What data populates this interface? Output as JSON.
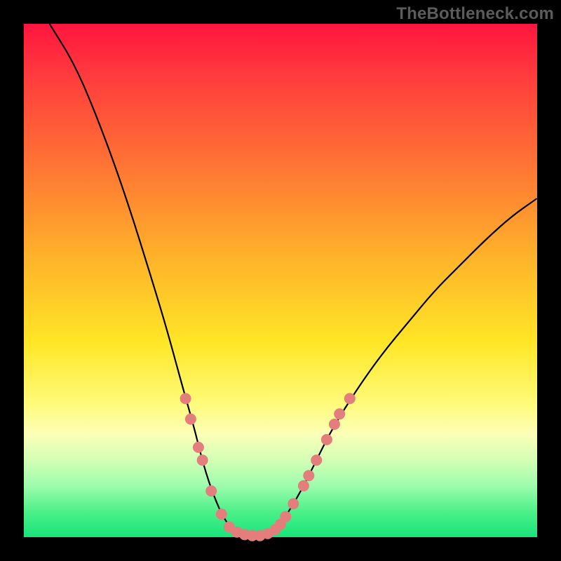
{
  "watermark": "TheBottleneck.com",
  "colors": {
    "curve_stroke": "#000000",
    "marker_fill": "#e47e7c",
    "marker_stroke": "#c95a58",
    "frame_bg": "#000000"
  },
  "chart_data": {
    "type": "line",
    "title": "",
    "xlabel": "",
    "ylabel": "",
    "xlim": [
      0,
      100
    ],
    "ylim": [
      0,
      100
    ],
    "grid": false,
    "legend": false,
    "curve": [
      {
        "x": 5.0,
        "y": 100.0
      },
      {
        "x": 10.0,
        "y": 92.0
      },
      {
        "x": 15.0,
        "y": 80.0
      },
      {
        "x": 20.0,
        "y": 66.0
      },
      {
        "x": 25.0,
        "y": 50.0
      },
      {
        "x": 28.0,
        "y": 40.0
      },
      {
        "x": 31.0,
        "y": 29.0
      },
      {
        "x": 33.0,
        "y": 22.0
      },
      {
        "x": 35.0,
        "y": 14.0
      },
      {
        "x": 37.0,
        "y": 8.0
      },
      {
        "x": 39.0,
        "y": 3.5
      },
      {
        "x": 41.0,
        "y": 1.2
      },
      {
        "x": 43.0,
        "y": 0.4
      },
      {
        "x": 45.0,
        "y": 0.2
      },
      {
        "x": 47.0,
        "y": 0.4
      },
      {
        "x": 49.0,
        "y": 1.5
      },
      {
        "x": 51.0,
        "y": 4.0
      },
      {
        "x": 54.0,
        "y": 9.0
      },
      {
        "x": 57.0,
        "y": 15.0
      },
      {
        "x": 60.0,
        "y": 21.0
      },
      {
        "x": 65.0,
        "y": 29.0
      },
      {
        "x": 70.0,
        "y": 36.0
      },
      {
        "x": 75.0,
        "y": 42.0
      },
      {
        "x": 80.0,
        "y": 48.0
      },
      {
        "x": 85.0,
        "y": 53.0
      },
      {
        "x": 90.0,
        "y": 58.0
      },
      {
        "x": 95.0,
        "y": 62.5
      },
      {
        "x": 100.0,
        "y": 66.0
      }
    ],
    "markers": [
      {
        "x": 31.5,
        "y": 27.0
      },
      {
        "x": 32.5,
        "y": 23.0
      },
      {
        "x": 34.0,
        "y": 17.5
      },
      {
        "x": 34.8,
        "y": 15.0
      },
      {
        "x": 36.5,
        "y": 9.0
      },
      {
        "x": 38.5,
        "y": 4.5
      },
      {
        "x": 40.0,
        "y": 2.0
      },
      {
        "x": 41.5,
        "y": 1.0
      },
      {
        "x": 43.0,
        "y": 0.5
      },
      {
        "x": 44.5,
        "y": 0.3
      },
      {
        "x": 46.0,
        "y": 0.3
      },
      {
        "x": 47.5,
        "y": 0.7
      },
      {
        "x": 49.0,
        "y": 1.5
      },
      {
        "x": 50.0,
        "y": 2.5
      },
      {
        "x": 51.0,
        "y": 4.0
      },
      {
        "x": 52.5,
        "y": 6.5
      },
      {
        "x": 54.5,
        "y": 10.0
      },
      {
        "x": 55.5,
        "y": 12.0
      },
      {
        "x": 57.0,
        "y": 15.0
      },
      {
        "x": 59.0,
        "y": 19.0
      },
      {
        "x": 60.5,
        "y": 22.0
      },
      {
        "x": 61.5,
        "y": 24.0
      },
      {
        "x": 63.5,
        "y": 27.0
      }
    ]
  }
}
